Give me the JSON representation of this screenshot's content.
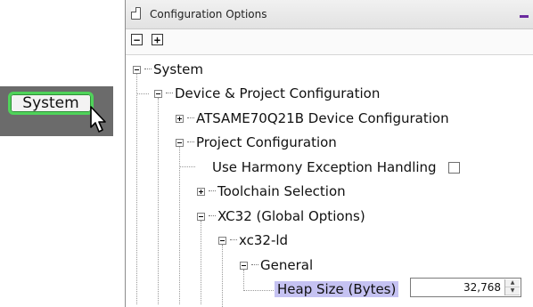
{
  "callout": {
    "button_label": "System"
  },
  "window": {
    "title": "Configuration Options"
  },
  "toolbar": {
    "collapse_all": "−",
    "expand_all": "+"
  },
  "tree": {
    "system": "System",
    "device_project": "Device & Project Configuration",
    "device_config": "ATSAME70Q21B Device Configuration",
    "project_config": "Project Configuration",
    "harmony_exception": "Use Harmony Exception Handling",
    "toolchain": "Toolchain Selection",
    "xc32_global": "XC32 (Global Options)",
    "xc32_ld": "xc32-ld",
    "general": "General",
    "heap_size": "Heap Size (Bytes)"
  },
  "heap_size_value": "32,768",
  "harmony_exception_checked": false,
  "colors": {
    "callout_border": "#4fd35a",
    "selection": "#c5c2f2",
    "minimize": "#6a2a9e"
  }
}
